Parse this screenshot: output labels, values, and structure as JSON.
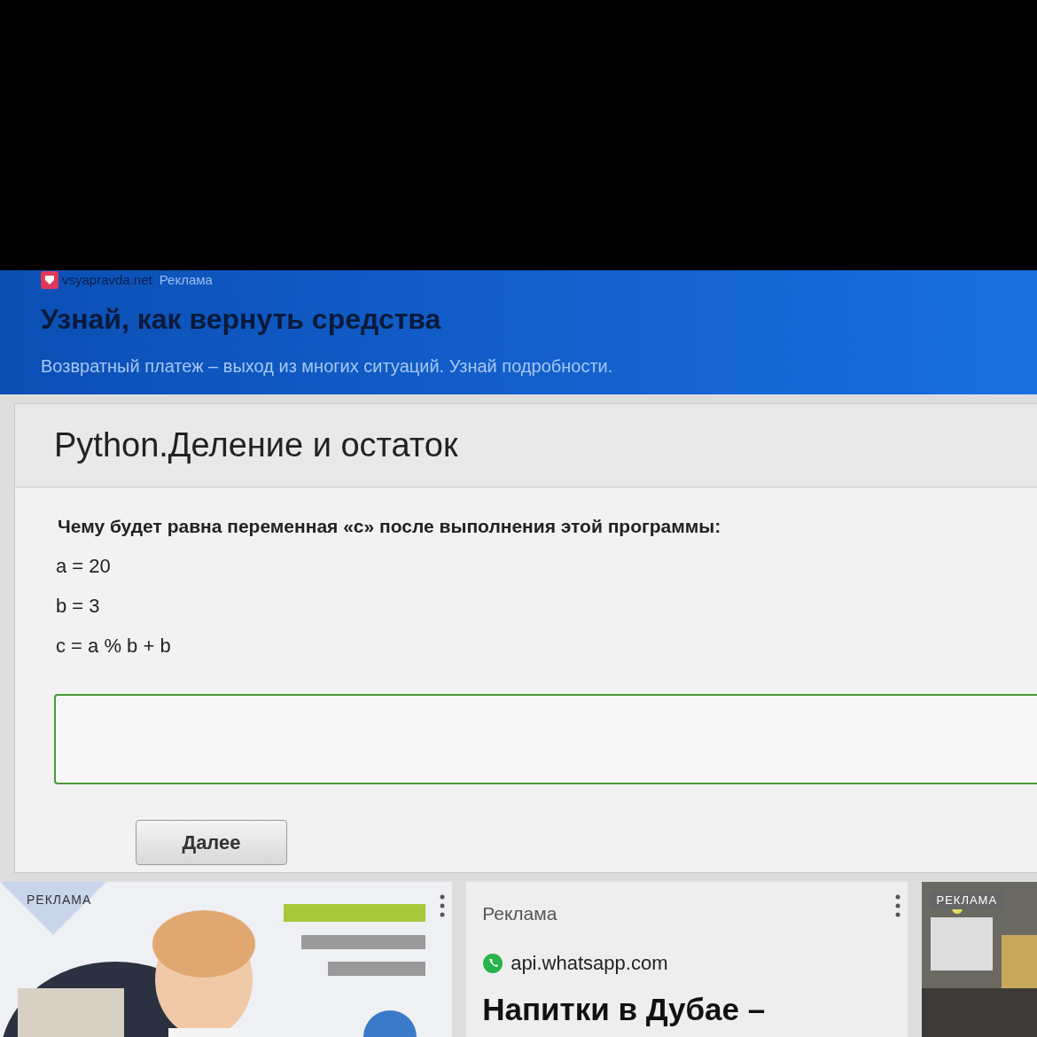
{
  "top_ad": {
    "domain": "vsyapravda.net",
    "label": "Реклама",
    "title": "Узнай, как вернуть средства",
    "text": "Возвратный платеж – выход из многих ситуаций. Узнай подробности."
  },
  "task": {
    "title": "Python.Деление и остаток",
    "question": "Чему будет равна переменная «c» после выполнения этой программы:",
    "code_lines": [
      "a = 20",
      "b = 3",
      "c = a % b + b"
    ],
    "button": "Далее"
  },
  "ads": [
    {
      "label": "РЕКЛАМА"
    },
    {
      "kind": "text",
      "label": "Реклама",
      "domain": "api.whatsapp.com",
      "title": "Напитки в Дубае –"
    },
    {
      "label": "РЕКЛАМА"
    }
  ]
}
